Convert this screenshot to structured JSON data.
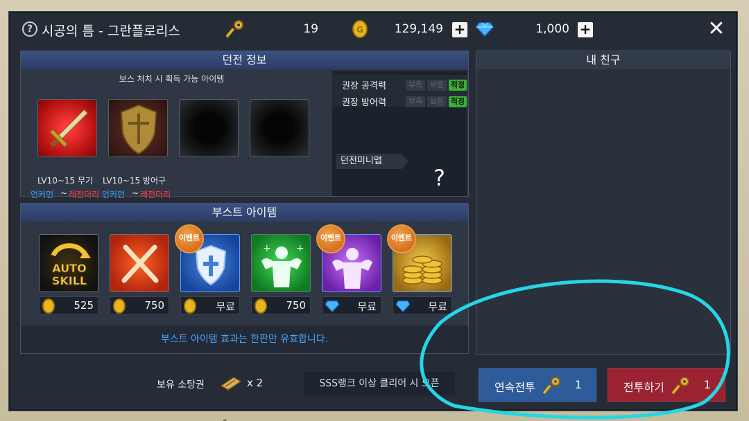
{
  "header": {
    "help_icon": "?",
    "title": "시공의 틈 - 그란플로리스",
    "keys": "19",
    "gold": "129,149",
    "gems": "1,000",
    "plus": "+",
    "close": "✕"
  },
  "dungeon_info": {
    "heading": "던전 정보",
    "subtitle": "보스 처치 시 획득 가능 아이템",
    "rewards": [
      {
        "label": "LV10~15 무기",
        "rarity_from": "언커먼",
        "sep": "~",
        "rarity_to": "레전더리"
      },
      {
        "label": "LV10~15 방어구",
        "rarity_from": "언커먼",
        "sep": "~",
        "rarity_to": "레전더리"
      }
    ],
    "recommend": {
      "attack_label": "권장 공격력",
      "defense_label": "권장 방어력",
      "levels": [
        "부족",
        "보통",
        "적정"
      ]
    },
    "minimap_label": "던전미니맵",
    "minimap_unknown": "?"
  },
  "boost_items": {
    "heading": "부스트 아이템",
    "items": [
      {
        "icon": "auto-skill-icon",
        "currency": "gold",
        "price": "525",
        "event": false,
        "tile_text": "AUTO\nSKILL"
      },
      {
        "icon": "crossed-swords-icon",
        "currency": "gold",
        "price": "750",
        "event": false
      },
      {
        "icon": "shield-cross-icon",
        "currency": "gold",
        "price": "무료",
        "event": true
      },
      {
        "icon": "strength-green-icon",
        "currency": "gold",
        "price": "750",
        "event": false
      },
      {
        "icon": "strength-purple-icon",
        "currency": "gem",
        "price": "무료",
        "event": true
      },
      {
        "icon": "gold-coins-icon",
        "currency": "gem",
        "price": "무료",
        "event": true
      }
    ],
    "event_label": "이벤트",
    "note": "부스트 아이템 효과는 한판만 유효합니다."
  },
  "friends": {
    "heading": "내 친구"
  },
  "footer": {
    "owned_label": "보유 소탕권",
    "owned_value": "x 2",
    "sss_text": "SSS랭크 이상 클리어 시 오픈",
    "continuous_label": "연속전투",
    "continuous_count": "1",
    "fight_label": "전투하기",
    "fight_count": "1"
  },
  "colors": {
    "panel_head": "#3a5182",
    "accent_blue": "#45a6ff",
    "continuous_btn": "#2e5b99",
    "fight_btn": "#9b2230",
    "annotation": "#25d6e6"
  }
}
